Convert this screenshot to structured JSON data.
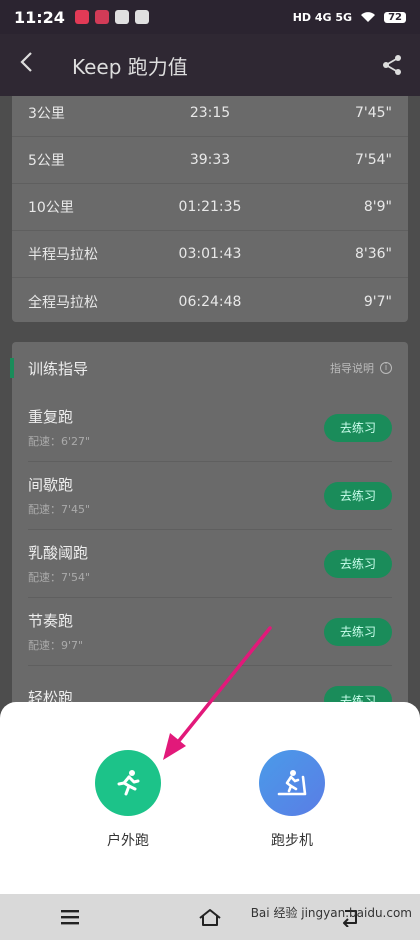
{
  "status": {
    "time": "11:24",
    "network": "HD 4G 5G",
    "battery": "72"
  },
  "header": {
    "title": "Keep 跑力值"
  },
  "pace_table": [
    {
      "distance": "3公里",
      "time": "23:15",
      "pace": "7'45\""
    },
    {
      "distance": "5公里",
      "time": "39:33",
      "pace": "7'54\""
    },
    {
      "distance": "10公里",
      "time": "01:21:35",
      "pace": "8'9\""
    },
    {
      "distance": "半程马拉松",
      "time": "03:01:43",
      "pace": "8'36\""
    },
    {
      "distance": "全程马拉松",
      "time": "06:24:48",
      "pace": "9'7\""
    }
  ],
  "training": {
    "title": "训练指导",
    "note": "指导说明",
    "items": [
      {
        "name": "重复跑",
        "pace": "配速：6'27\"",
        "button": "去练习"
      },
      {
        "name": "间歇跑",
        "pace": "配速：7'45\"",
        "button": "去练习"
      },
      {
        "name": "乳酸阈跑",
        "pace": "配速：7'54\"",
        "button": "去练习"
      },
      {
        "name": "节奏跑",
        "pace": "配速：9'7\"",
        "button": "去练习"
      },
      {
        "name": "轻松跑",
        "pace": "",
        "button": "去练习"
      }
    ]
  },
  "sheet": {
    "outdoor_label": "户外跑",
    "treadmill_label": "跑步机"
  },
  "watermark": "Bai 经验 jingyan.baidu.com"
}
